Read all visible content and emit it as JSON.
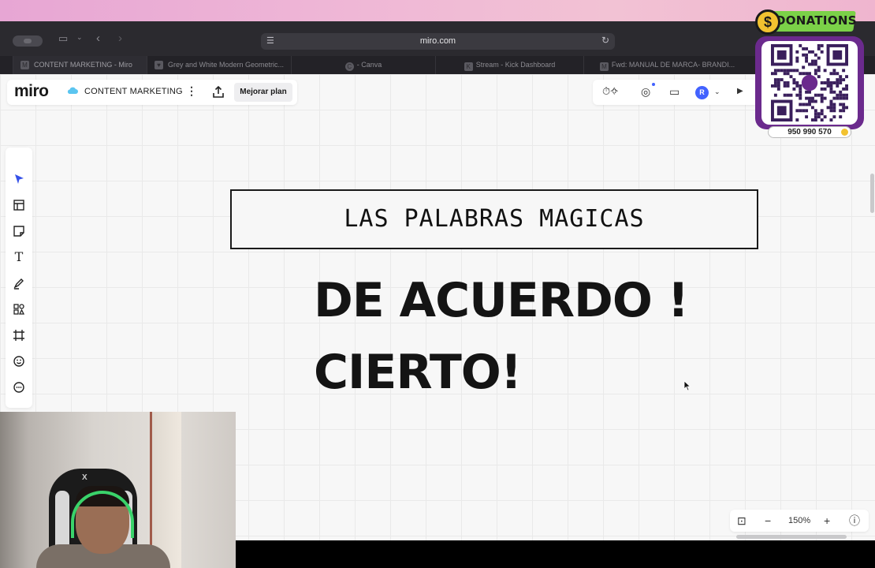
{
  "os": {
    "apple_logo": ""
  },
  "browser": {
    "url": "miro.com",
    "tabs": [
      {
        "label": "CONTENT MARKETING - Miro",
        "favicon": "M",
        "active": true
      },
      {
        "label": "Grey and White Modern Geometric...",
        "favicon": "",
        "active": false
      },
      {
        "label": "- Canva",
        "favicon": "C",
        "active": false
      },
      {
        "label": "Stream - Kick Dashboard",
        "favicon": "K",
        "active": false
      },
      {
        "label": "Fwd: MANUAL DE MARCA- BRANDI...",
        "favicon": "M",
        "active": false
      }
    ]
  },
  "miro": {
    "logo": "miro",
    "board_name": "CONTENT MARKETING",
    "upgrade_label": "Mejorar plan",
    "avatar_initial": "R",
    "zoom": "150%",
    "accent_color": "#4262ff"
  },
  "board": {
    "frame_title": "LAS PALABRAS MAGICAS",
    "line1": "DE ACUERDO !",
    "line2": "CIERTO!"
  },
  "overlay": {
    "donations_label": "DONATIONS",
    "coin_symbol": "$",
    "phone": "950 990 570"
  },
  "webcam": {
    "chair_brand": "X"
  }
}
